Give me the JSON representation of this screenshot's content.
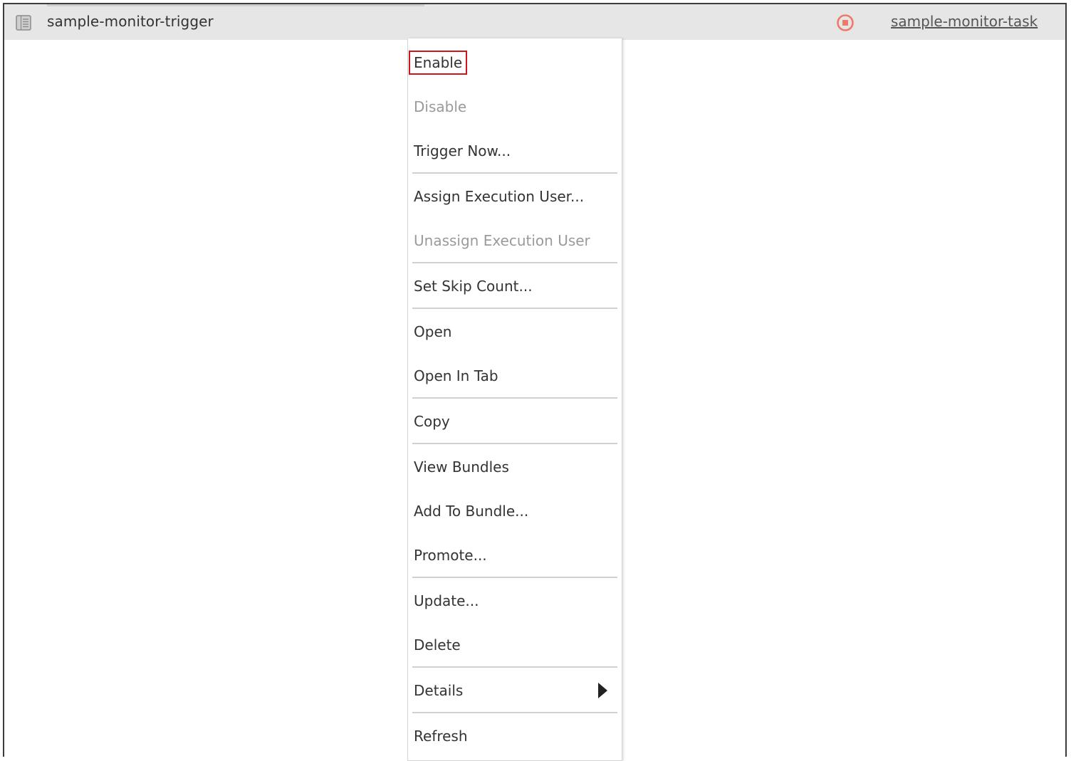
{
  "row": {
    "name": "sample-monitor-trigger",
    "icon": "document-list-icon",
    "status_icon": "stopped-status-icon",
    "status_color": "#f07a6a",
    "task_link": "sample-monitor-task"
  },
  "menu": {
    "items": [
      {
        "label": "Enable",
        "disabled": false,
        "selected": true
      },
      {
        "label": "Disable",
        "disabled": true
      },
      {
        "label": "Trigger Now...",
        "disabled": false
      },
      {
        "label": "Assign Execution User...",
        "disabled": false
      },
      {
        "label": "Unassign Execution User",
        "disabled": true
      },
      {
        "label": "Set Skip Count...",
        "disabled": false
      },
      {
        "label": "Open",
        "disabled": false
      },
      {
        "label": "Open In Tab",
        "disabled": false
      },
      {
        "label": "Copy",
        "disabled": false
      },
      {
        "label": "View Bundles",
        "disabled": false
      },
      {
        "label": "Add To Bundle...",
        "disabled": false
      },
      {
        "label": "Promote...",
        "disabled": false
      },
      {
        "label": "Update...",
        "disabled": false
      },
      {
        "label": "Delete",
        "disabled": false
      },
      {
        "label": "Details",
        "disabled": false,
        "submenu": true
      },
      {
        "label": "Refresh",
        "disabled": false
      }
    ],
    "highlight_color": "#d0141c"
  }
}
